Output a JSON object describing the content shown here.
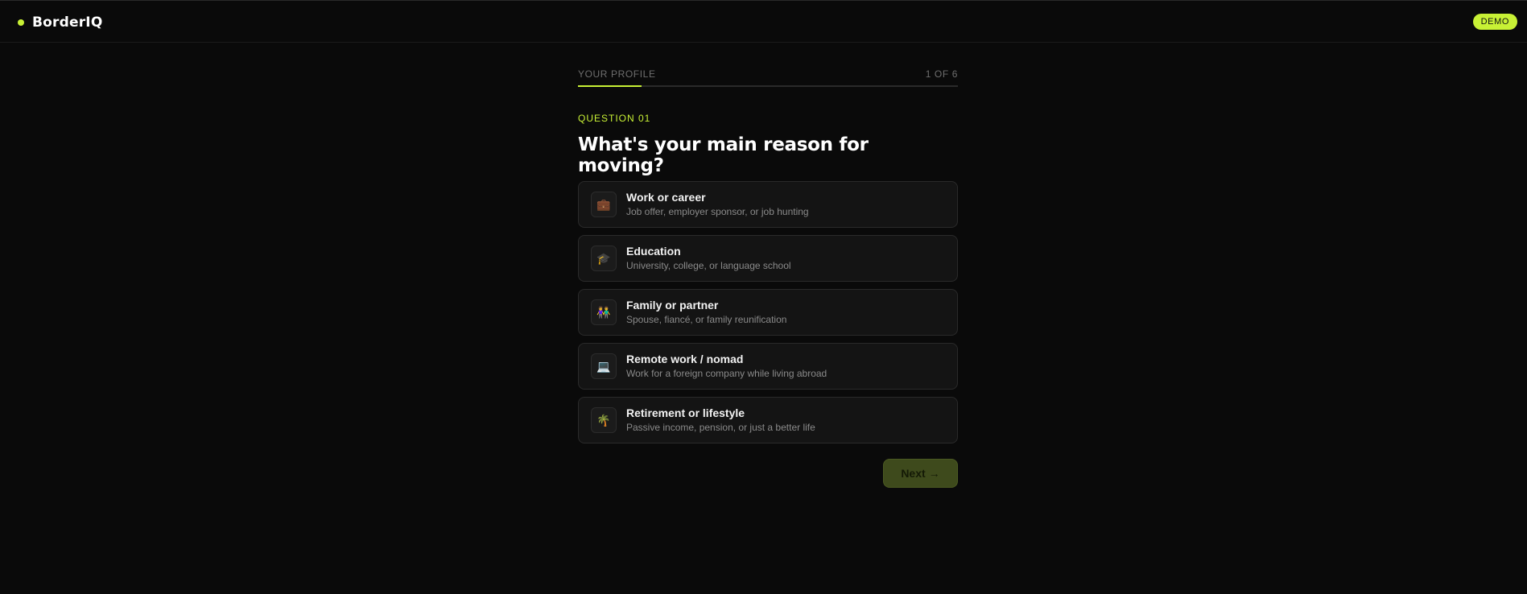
{
  "header": {
    "brand": "BorderIQ",
    "badge": "DEMO",
    "accent_color": "#c8f135"
  },
  "progress": {
    "section": "YOUR PROFILE",
    "step_text": "1 OF 6",
    "current_step": 1,
    "total_steps": 6
  },
  "question": {
    "label": "QUESTION 01",
    "title": "What's your main reason for moving?"
  },
  "options": [
    {
      "icon": "briefcase-icon",
      "glyph": "💼",
      "title": "Work or career",
      "desc": "Job offer, employer sponsor, or job hunting"
    },
    {
      "icon": "graduation-cap-icon",
      "glyph": "🎓",
      "title": "Education",
      "desc": "University, college, or language school"
    },
    {
      "icon": "family-icon",
      "glyph": "👫",
      "title": "Family or partner",
      "desc": "Spouse, fiancé, or family reunification"
    },
    {
      "icon": "laptop-icon",
      "glyph": "💻",
      "title": "Remote work / nomad",
      "desc": "Work for a foreign company while living abroad"
    },
    {
      "icon": "palm-tree-icon",
      "glyph": "🌴",
      "title": "Retirement or lifestyle",
      "desc": "Passive income, pension, or just a better life"
    }
  ],
  "actions": {
    "next_label": "Next",
    "next_arrow": "→"
  }
}
